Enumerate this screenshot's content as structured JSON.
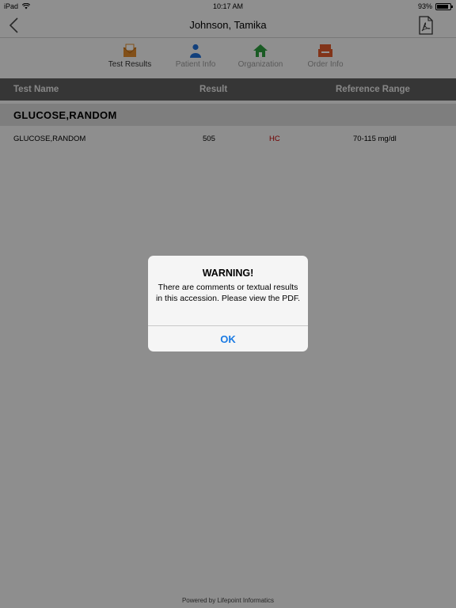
{
  "status_bar": {
    "device": "iPad",
    "time": "10:17 AM",
    "battery": "93%"
  },
  "nav": {
    "title": "Johnson, Tamika",
    "back_icon": "chevron-left-icon",
    "pdf_icon": "pdf-document-icon"
  },
  "tabs": [
    {
      "label": "Test Results",
      "icon": "envelope-icon",
      "color": "#e08a2b",
      "active": true
    },
    {
      "label": "Patient Info",
      "icon": "person-icon",
      "color": "#1f6fd6",
      "active": false
    },
    {
      "label": "Organization",
      "icon": "house-icon",
      "color": "#2e9e3e",
      "active": false
    },
    {
      "label": "Order Info",
      "icon": "tray-icon",
      "color": "#e05a2b",
      "active": false
    }
  ],
  "table": {
    "headers": {
      "test_name": "Test Name",
      "result": "Result",
      "reference_range": "Reference Range"
    },
    "group": "GLUCOSE,RANDOM",
    "rows": [
      {
        "test_name": "GLUCOSE,RANDOM",
        "result": "505",
        "flag": "HC",
        "reference_range": "70-115 mg/dl"
      }
    ]
  },
  "footer": "Powered by Lifepoint Informatics",
  "alert": {
    "title": "WARNING!",
    "message": "There are comments or textual results in this accession. Please view the PDF.",
    "ok_label": "OK"
  },
  "colors": {
    "accent": "#1a7ae3",
    "flag": "#c00000",
    "header_bg": "#5e5e5e"
  }
}
